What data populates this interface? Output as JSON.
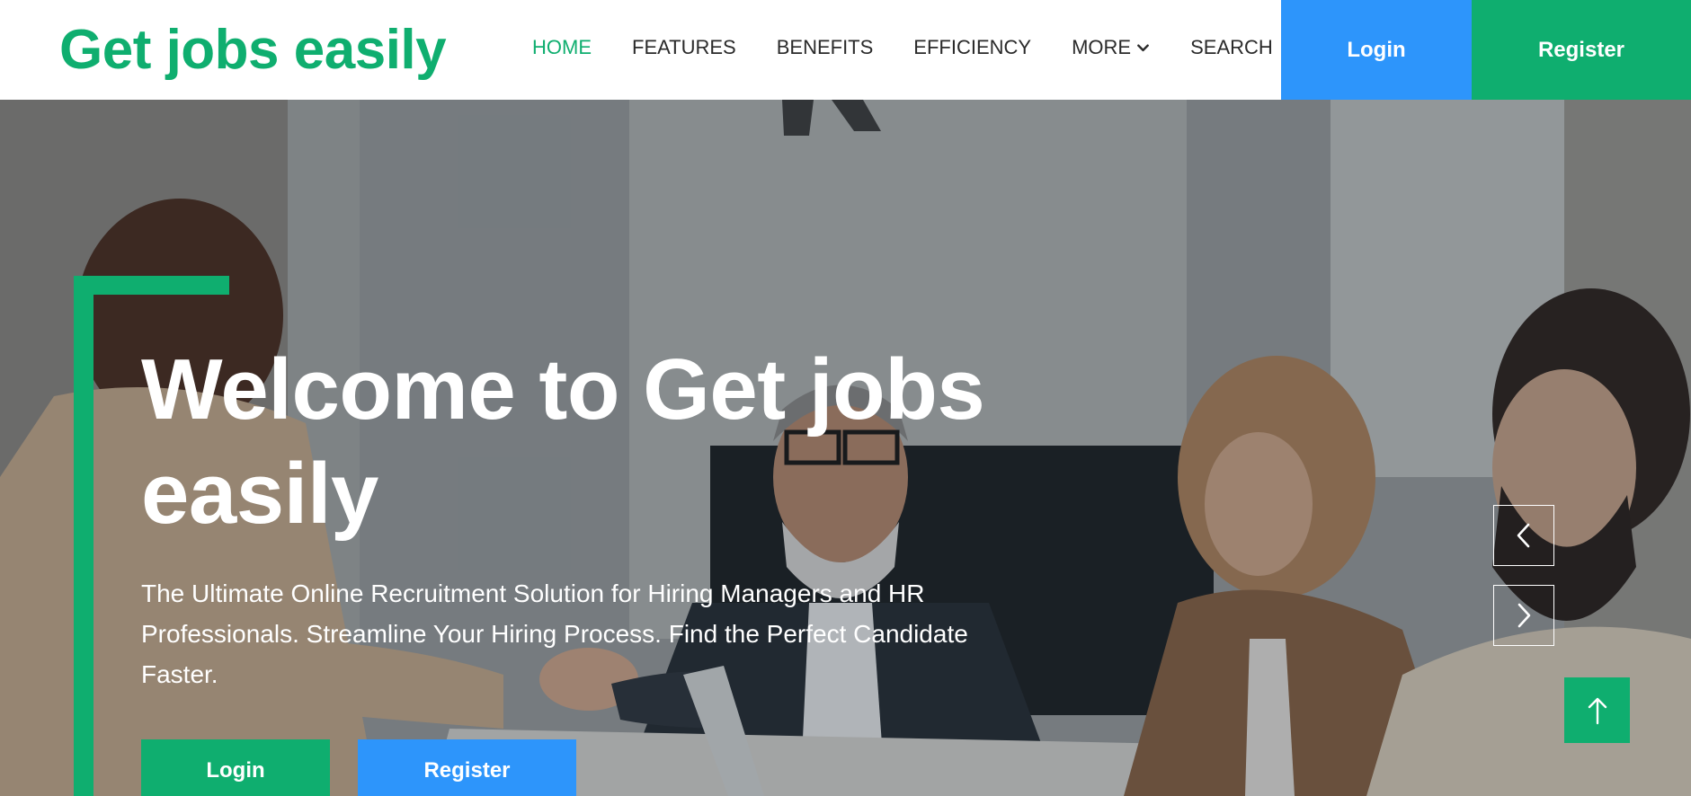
{
  "brand": {
    "name": "Get jobs easily"
  },
  "nav": {
    "items": [
      {
        "label": "HOME",
        "active": true
      },
      {
        "label": "FEATURES",
        "active": false
      },
      {
        "label": "BENEFITS",
        "active": false
      },
      {
        "label": "EFFICIENCY",
        "active": false
      },
      {
        "label": "MORE",
        "active": false,
        "icon": "chevron-down-icon"
      },
      {
        "label": "SEARCH",
        "active": false
      }
    ],
    "login_label": "Login",
    "register_label": "Register"
  },
  "hero": {
    "title": "Welcome to Get jobs easily",
    "subtitle": "The Ultimate Online Recruitment Solution for Hiring Managers and HR Professionals. Streamline Your Hiring Process. Find the Perfect Candidate Faster.",
    "login_label": "Login",
    "register_label": "Register",
    "background_icon": "office-meeting-handshake-photo"
  },
  "carousel": {
    "prev_icon": "chevron-left-icon",
    "next_icon": "chevron-right-icon"
  },
  "back_to_top": {
    "icon": "arrow-up-icon"
  },
  "colors": {
    "accent_green": "#0fae6f",
    "accent_blue": "#2d95fb",
    "text_dark": "#2a2a2a"
  }
}
